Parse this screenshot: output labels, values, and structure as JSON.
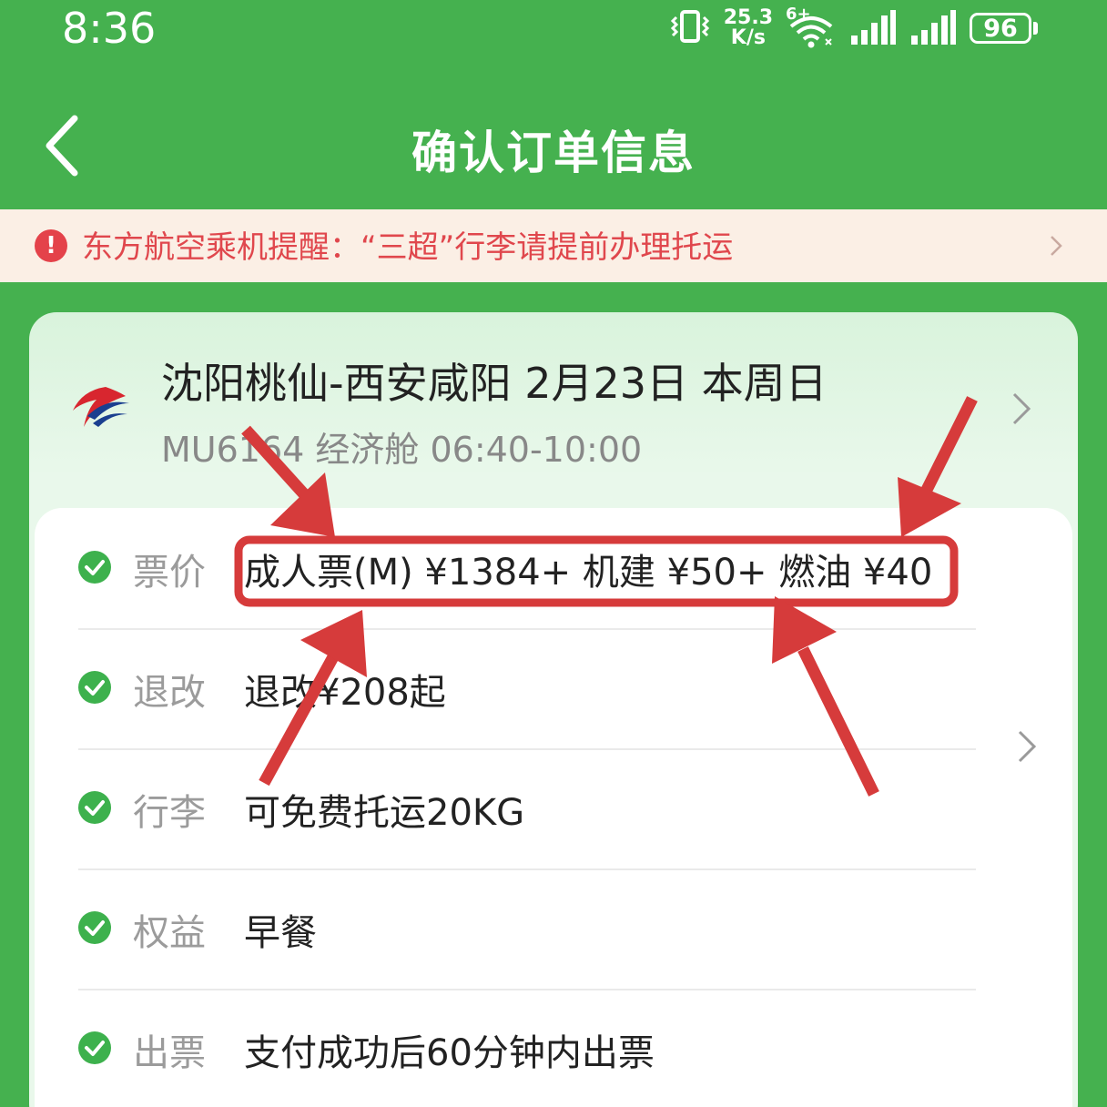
{
  "status_bar": {
    "time": "8:36",
    "net_speed_value": "25.3",
    "net_speed_unit": "K/s",
    "wifi_badge": "6+",
    "battery": "96",
    "icons": [
      "vibrate-icon",
      "wifi-icon",
      "signal-icon",
      "signal-icon",
      "battery-icon"
    ]
  },
  "nav": {
    "title": "确认订单信息",
    "back_icon": "chevron-left-icon"
  },
  "notice": {
    "text": "东方航空乘机提醒：“三超”行李请提前办理托运",
    "icon": "exclamation-icon"
  },
  "flight": {
    "route": "沈阳桃仙-西安咸阳 2月23日   本周日",
    "info": "MU6164 经济舱 06:40-10:00",
    "logo": "china-eastern-logo"
  },
  "details": [
    {
      "label": "票价",
      "value": "成人票(M) ¥1384+ 机建 ¥50+ 燃油 ¥40"
    },
    {
      "label": "退改",
      "value": "退改¥208起"
    },
    {
      "label": "行李",
      "value": "可免费托运20KG"
    },
    {
      "label": "权益",
      "value": "早餐"
    },
    {
      "label": "出票",
      "value": "支付成功后60分钟内出票"
    }
  ],
  "colors": {
    "brand_green": "#45b14f",
    "notice_red": "#e0474d",
    "annotation_red": "#d63b3b",
    "check_green": "#3db14d"
  }
}
